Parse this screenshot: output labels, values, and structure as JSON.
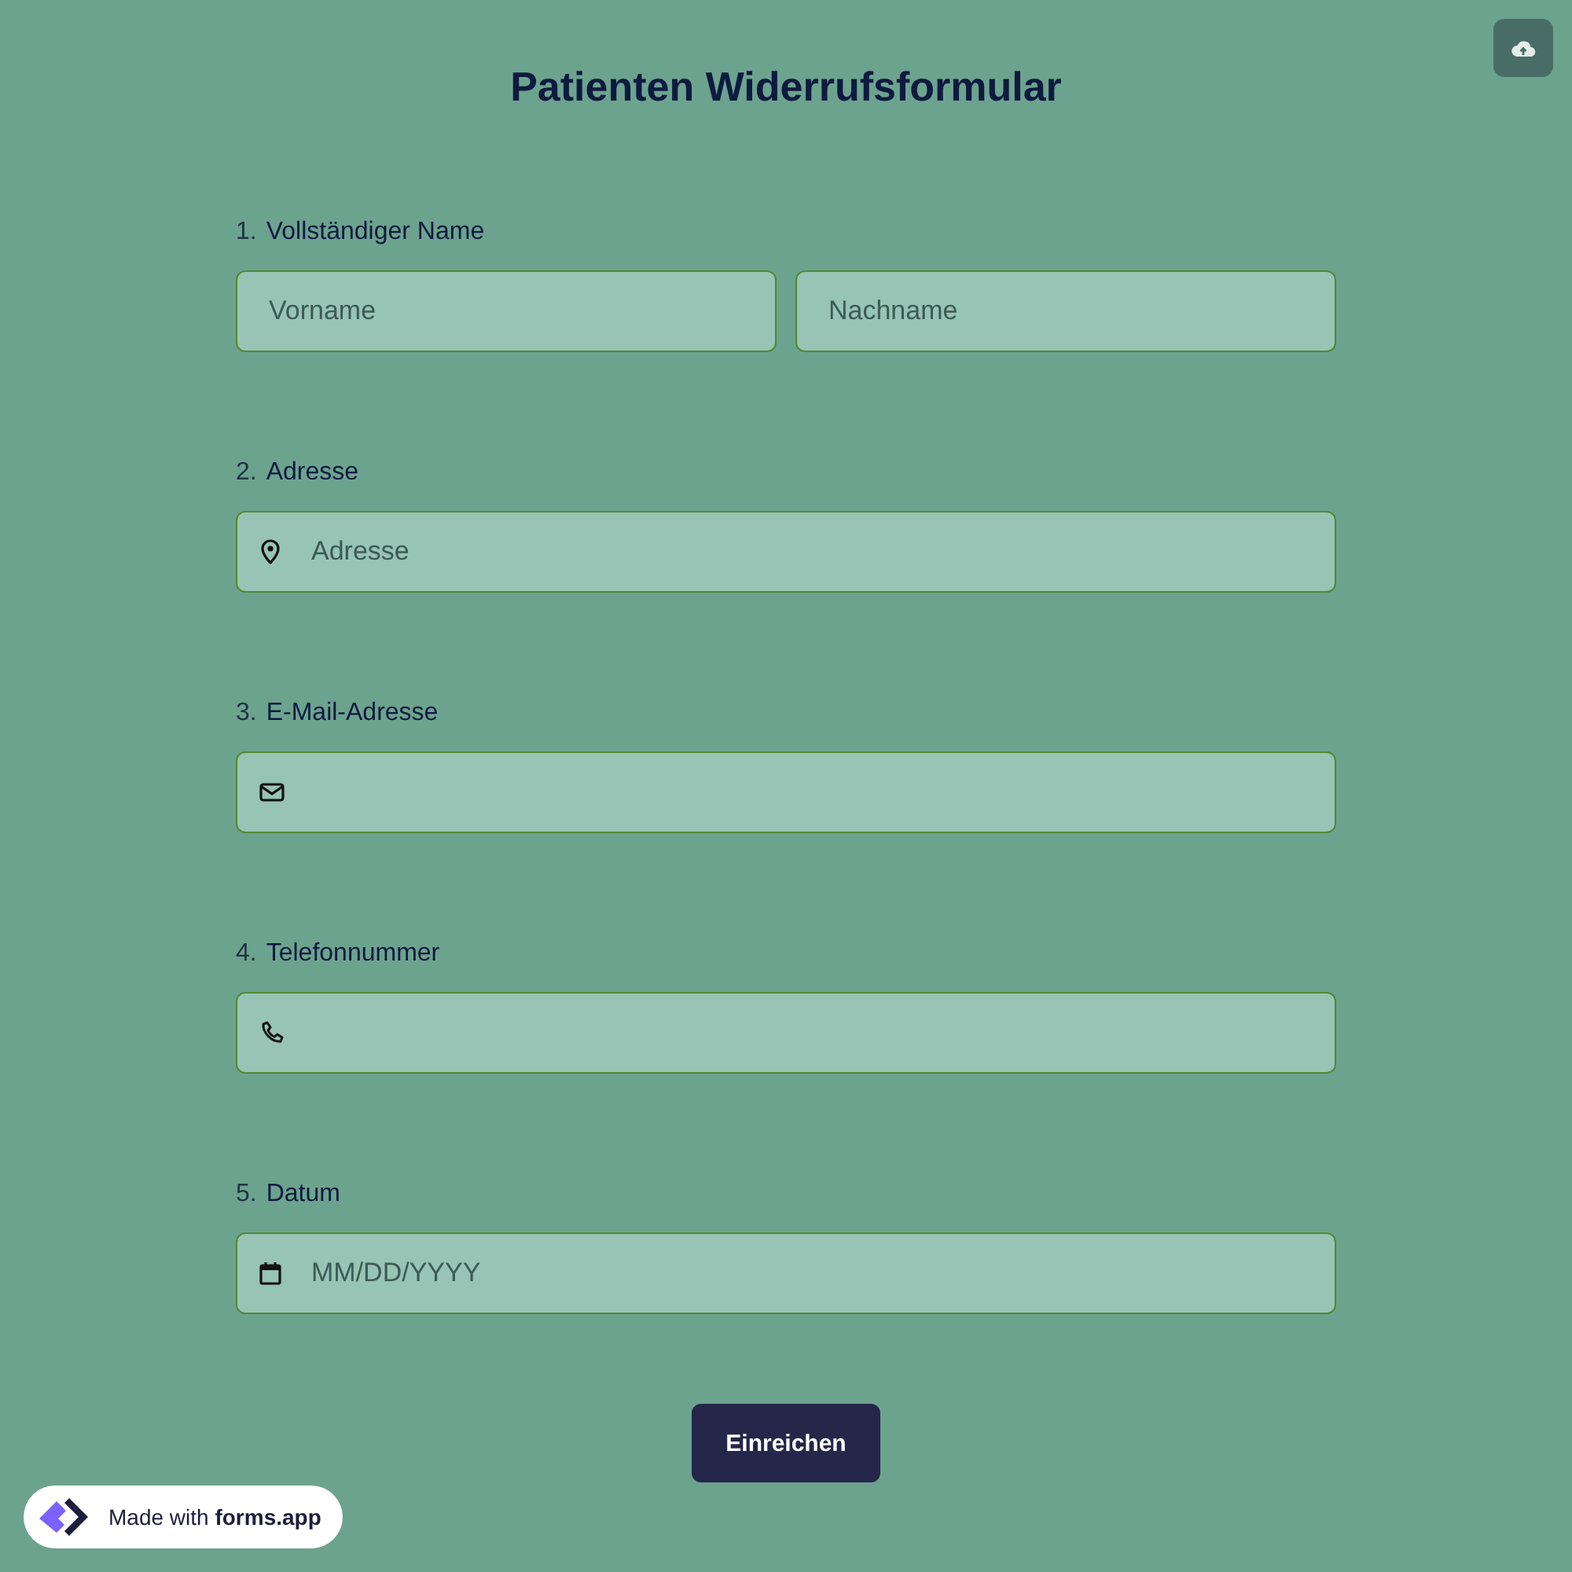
{
  "title": "Patienten Widerrufsformular",
  "questions": [
    {
      "number": "1.",
      "label": "Vollständiger Name",
      "kind": "name",
      "placeholders": [
        "Vorname",
        "Nachname"
      ]
    },
    {
      "number": "2.",
      "label": "Adresse",
      "kind": "address",
      "placeholders": [
        "Adresse"
      ]
    },
    {
      "number": "3.",
      "label": "E-Mail-Adresse",
      "kind": "email"
    },
    {
      "number": "4.",
      "label": "Telefonnummer",
      "kind": "phone"
    },
    {
      "number": "5.",
      "label": "Datum",
      "kind": "date",
      "placeholders": [
        "MM/DD/YYYY"
      ]
    }
  ],
  "submit": "Einreichen",
  "badge": {
    "prefix": "Made with",
    "brand": "forms.app"
  }
}
